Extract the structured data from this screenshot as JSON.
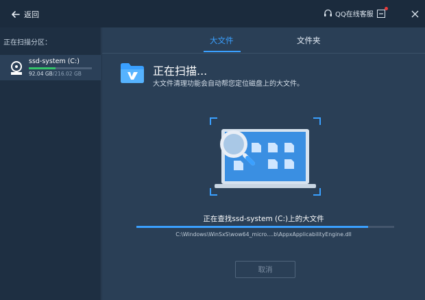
{
  "titlebar": {
    "back_label": "返回",
    "support_label": "QQ在线客服"
  },
  "left_panel": {
    "heading": "正在扫描分区：",
    "drive": {
      "name": "ssd-system (C:)",
      "used": "92.04 GB",
      "total": "/216.02 GB",
      "usage_fraction": 0.426
    }
  },
  "tabs": [
    {
      "label": "大文件",
      "active": true
    },
    {
      "label": "文件夹",
      "active": false
    }
  ],
  "scan": {
    "title": "正在扫描...",
    "subtitle": "大文件清理功能会自动帮您定位磁盘上的大文件。",
    "status": "正在查找ssd-system (C:)上的大文件",
    "progress": 0.9,
    "current_path": "C:\\Windows\\WinSxS\\wow64_micro....b\\AppxApplicabilityEngine.dll",
    "cancel_label": "取消"
  },
  "colors": {
    "accent": "#3aa0ff",
    "progress_green": "#35c46a",
    "background": "#2a3f56",
    "notification": "#e83a3a"
  },
  "icons": [
    "back-arrow-icon",
    "headset-icon",
    "minimize-icon",
    "close-icon",
    "hard-drive-icon",
    "folder-icon",
    "laptop-scan-icon",
    "magnifier-icon"
  ]
}
